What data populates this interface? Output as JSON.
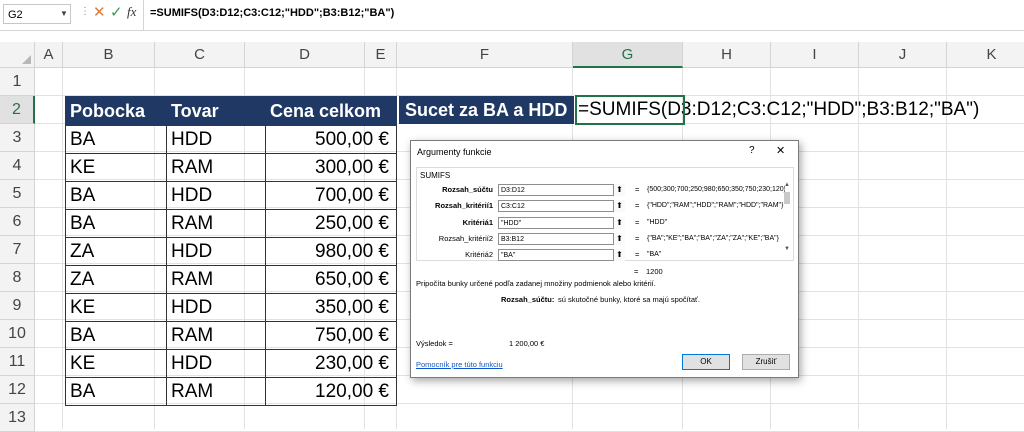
{
  "formula_bar": {
    "name_box": "G2",
    "cancel_glyph": "✕",
    "enter_glyph": "✓",
    "fx_label": "fx",
    "formula": "=SUMIFS(D3:D12;C3:C12;\"HDD\";B3:B12;\"BA\")"
  },
  "columns": [
    "A",
    "B",
    "C",
    "D",
    "E",
    "F",
    "G",
    "H",
    "I",
    "J",
    "K"
  ],
  "selected_column": "G",
  "rows": [
    "1",
    "2",
    "3",
    "4",
    "5",
    "6",
    "7",
    "8",
    "9",
    "10",
    "11",
    "12",
    "13"
  ],
  "selected_row": "2",
  "table": {
    "headers": [
      "Pobocka",
      "Tovar",
      "Cena celkom"
    ],
    "rows": [
      [
        "BA",
        "HDD",
        "500,00 €"
      ],
      [
        "KE",
        "RAM",
        "300,00 €"
      ],
      [
        "BA",
        "HDD",
        "700,00 €"
      ],
      [
        "BA",
        "RAM",
        "250,00 €"
      ],
      [
        "ZA",
        "HDD",
        "980,00 €"
      ],
      [
        "ZA",
        "RAM",
        "650,00 €"
      ],
      [
        "KE",
        "HDD",
        "350,00 €"
      ],
      [
        "BA",
        "RAM",
        "750,00 €"
      ],
      [
        "KE",
        "HDD",
        "230,00 €"
      ],
      [
        "BA",
        "RAM",
        "120,00 €"
      ]
    ]
  },
  "sum_label": "Sucet za BA a HDD",
  "g2_content": "=SUMIFS(D3:D12;C3:C12;\"HDD\";B3:B12;\"BA\")",
  "dialog": {
    "title": "Argumenty funkcie",
    "help_glyph": "?",
    "close_glyph": "✕",
    "function_name": "SUMIFS",
    "args": [
      {
        "label": "Rozsah_súčtu",
        "bold": true,
        "value": "D3:D12",
        "result": "{500;300;700;250;980;650;350;750;230;120}"
      },
      {
        "label": "Rozsah_kritérií1",
        "bold": true,
        "value": "C3:C12",
        "result": "{\"HDD\";\"RAM\";\"HDD\";\"RAM\";\"HDD\";\"RAM\"}"
      },
      {
        "label": "Kritériá1",
        "bold": true,
        "value": "\"HDD\"",
        "result": "\"HDD\""
      },
      {
        "label": "Rozsah_kritérií2",
        "bold": false,
        "value": "B3:B12",
        "result": "{\"BA\";\"KE\";\"BA\";\"BA\";\"ZA\";\"ZA\";\"KE\";\"BA\"}"
      },
      {
        "label": "Kritériá2",
        "bold": false,
        "value": "\"BA\"",
        "result": "\"BA\""
      }
    ],
    "eq_sign": "=",
    "total": "1200",
    "description": "Pripočíta bunky určené podľa zadanej množiny podmienok alebo kritérií.",
    "arg_desc_label": "Rozsah_súčtu:",
    "arg_desc_text": "sú skutočné bunky, ktoré sa majú spočítať.",
    "result_label": "Výsledok =",
    "result_value": "1 200,00 €",
    "help_link": "Pomocník pre túto funkciu",
    "ok_label": "OK",
    "cancel_label": "Zrušiť"
  }
}
